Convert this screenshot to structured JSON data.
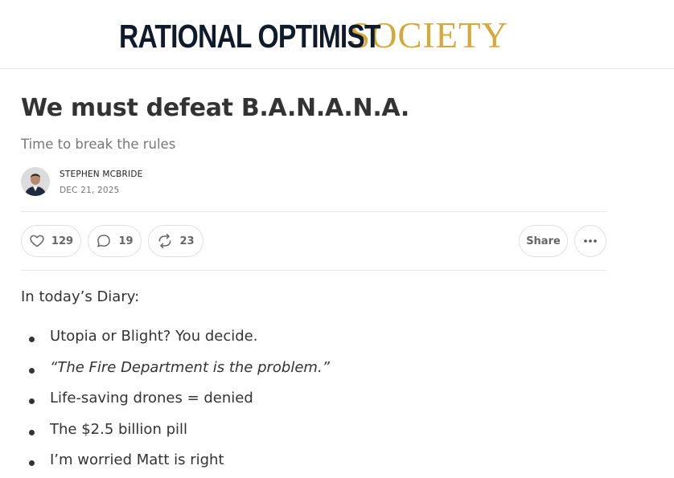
{
  "brand": {
    "name_part1": "RATIONAL OPTIMIST",
    "name_part2": "SOCIETY",
    "color_dark": "#0f1b2a",
    "color_gold": "#d4a93a"
  },
  "post": {
    "title": "We must defeat B.A.N.A.N.A.",
    "subtitle": "Time to break the rules",
    "author": "STEPHEN MCBRIDE",
    "date": "DEC 21, 2025"
  },
  "actions": {
    "likes": "129",
    "comments": "19",
    "restacks": "23",
    "share_label": "Share",
    "more_icon": "ellipsis-icon"
  },
  "body": {
    "intro": "In today’s Diary:",
    "bullets": [
      "Utopia or Blight? You decide.",
      "“The Fire Department is the problem.”",
      "Life-saving drones = denied",
      "The $2.5 billion pill",
      "I’m worried Matt is right"
    ]
  }
}
